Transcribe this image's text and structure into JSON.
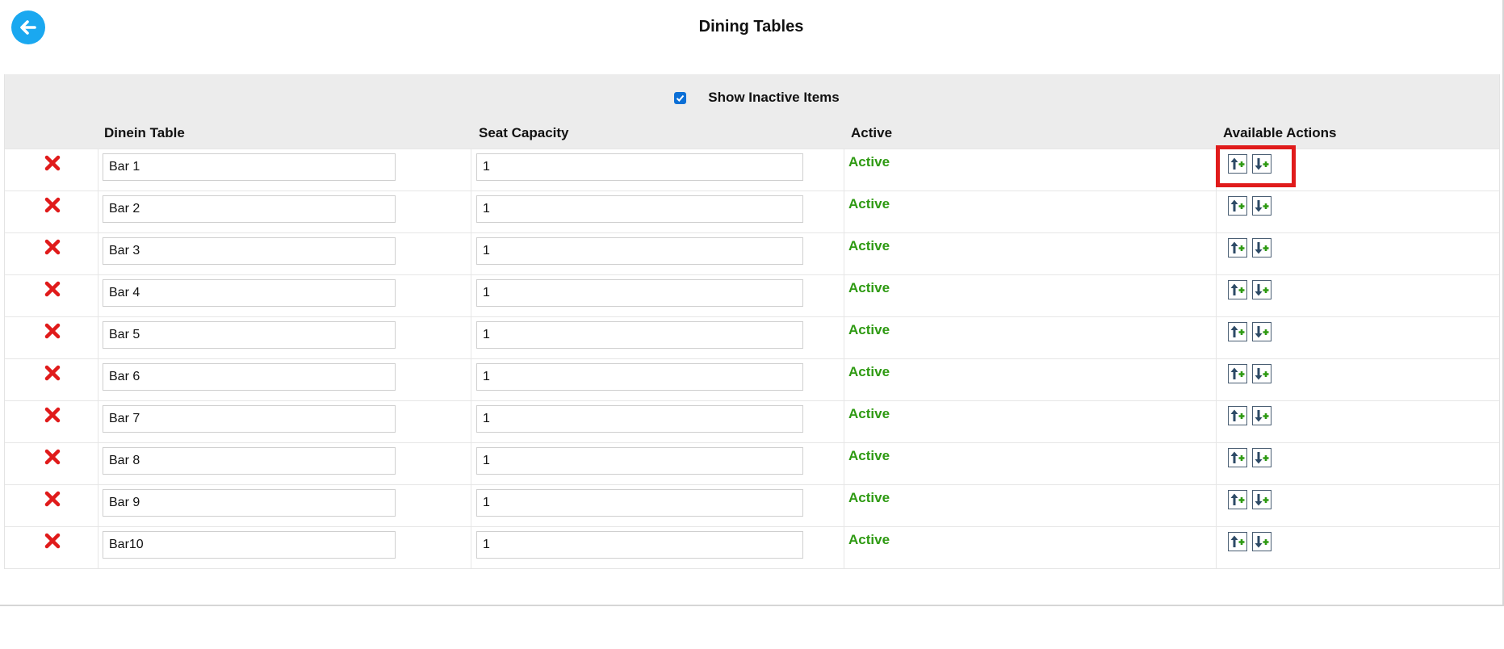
{
  "header": {
    "title": "Dining Tables"
  },
  "filter": {
    "show_inactive_label": "Show Inactive Items",
    "show_inactive_checked": true
  },
  "columns": {
    "name": "Dinein Table",
    "capacity": "Seat Capacity",
    "active": "Active",
    "actions": "Available Actions"
  },
  "rows": [
    {
      "name": "Bar 1",
      "capacity": "1",
      "status": "Active"
    },
    {
      "name": "Bar 2",
      "capacity": "1",
      "status": "Active"
    },
    {
      "name": "Bar 3",
      "capacity": "1",
      "status": "Active"
    },
    {
      "name": "Bar 4",
      "capacity": "1",
      "status": "Active"
    },
    {
      "name": "Bar 5",
      "capacity": "1",
      "status": "Active"
    },
    {
      "name": "Bar 6",
      "capacity": "1",
      "status": "Active"
    },
    {
      "name": "Bar 7",
      "capacity": "1",
      "status": "Active"
    },
    {
      "name": "Bar 8",
      "capacity": "1",
      "status": "Active"
    },
    {
      "name": "Bar 9",
      "capacity": "1",
      "status": "Active"
    },
    {
      "name": "Bar10",
      "capacity": "1",
      "status": "Active"
    }
  ],
  "icons": {
    "back": "arrow-left-icon",
    "delete": "red-x-icon",
    "insert_above": "insert-row-above-icon",
    "insert_below": "insert-row-below-icon"
  },
  "colors": {
    "accent": "#1aa8f0",
    "active_status": "#2e9a12",
    "delete": "#e01b1b",
    "highlight": "#e01b1b"
  }
}
